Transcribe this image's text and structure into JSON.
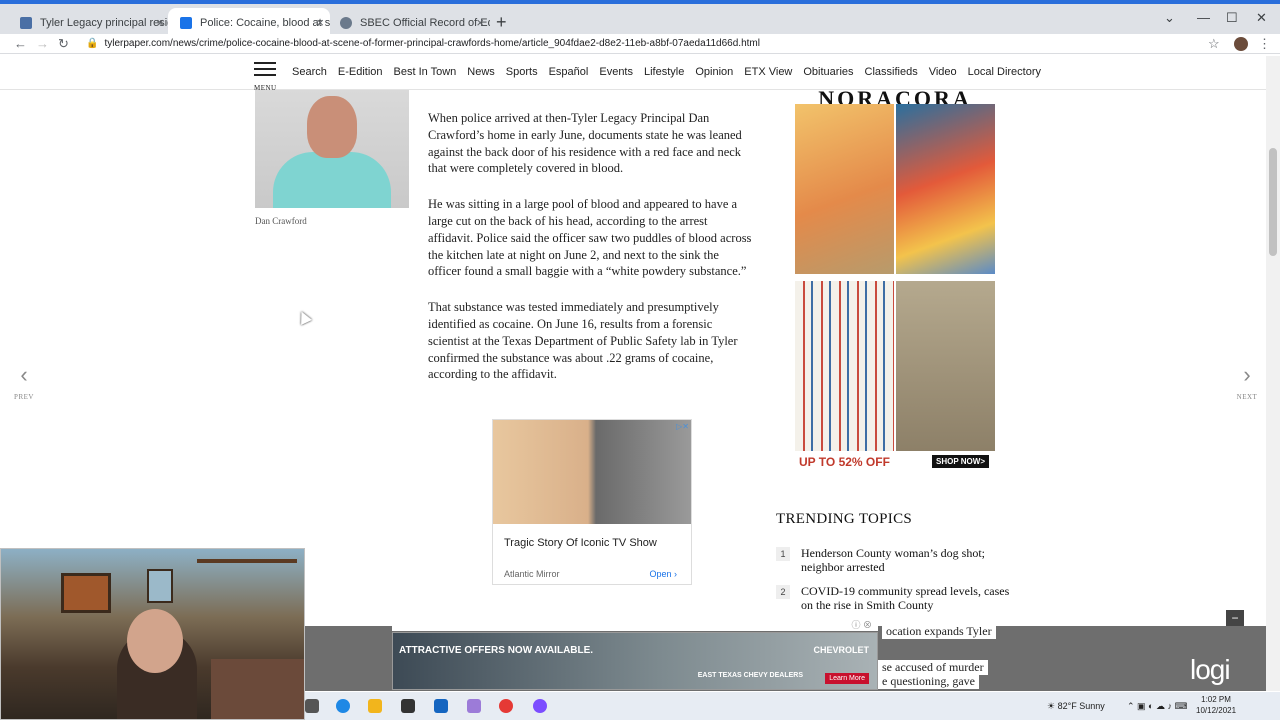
{
  "browser": {
    "tabs": [
      {
        "title": "Tyler Legacy principal resigns in",
        "favicon_color": "#4a6fa5",
        "active": false
      },
      {
        "title": "Police: Cocaine, blood at scene o",
        "favicon_color": "#1a73e8",
        "active": true
      },
      {
        "title": "SBEC Official Record of Educato",
        "favicon_color": "#6b7a8c",
        "active": false
      }
    ],
    "url": "tylerpaper.com/news/crime/police-cocaine-blood-at-scene-of-former-principal-crawfords-home/article_904fdae2-d8e2-11eb-a8bf-07aeda11d66d.html"
  },
  "site_nav": {
    "menu_label": "MENU",
    "links": [
      "Search",
      "E-Edition",
      "Best In Town",
      "News",
      "Sports",
      "Español",
      "Events",
      "Lifestyle",
      "Opinion",
      "ETX View",
      "Obituaries",
      "Classifieds",
      "Video",
      "Local Directory"
    ]
  },
  "article": {
    "photo_caption": "Dan Crawford",
    "paragraphs": [
      "When police arrived at then-Tyler Legacy Principal Dan Crawford’s home in early June, documents state he was leaned against the back door of his residence with a red face and neck that were completely covered in blood.",
      "He was sitting in a large pool of blood and appeared to have a large cut on the back of his head, according to the arrest affidavit. Police said the officer saw two puddles of blood across the kitchen late at night on June 2, and next to the sink the officer found a small baggie with a “white powdery substance.”",
      "That substance was tested immediately and presumptively identified as cocaine. On June 16, results from a forensic scientist at the Texas Department of Public Safety lab in Tyler confirmed the substance was about .22 grams of cocaine, according to the affidavit."
    ]
  },
  "inline_ad": {
    "title": "Tragic Story Of Iconic TV Show",
    "source": "Atlantic Mirror",
    "open_label": "Open"
  },
  "right_ad": {
    "brand": "NORACORA",
    "promo": "UP TO 52% OFF",
    "shop_label": "SHOP NOW>"
  },
  "trending": {
    "title": "TRENDING TOPICS",
    "items": [
      {
        "num": "1",
        "text": "Henderson County woman’s dog shot; neighbor arrested"
      },
      {
        "num": "2",
        "text": "COVID-19 community spread levels, cases on the rise in Smith County"
      },
      {
        "num": "",
        "text": "ocation expands Tyler"
      },
      {
        "num": "",
        "text": "se accused of murder"
      },
      {
        "num": "",
        "text": "e questioning, gave"
      }
    ]
  },
  "pager": {
    "prev": "PREV",
    "next": "NEXT"
  },
  "banner_ad": {
    "headline": "ATTRACTIVE OFFERS NOW AVAILABLE.",
    "brand": "CHEVROLET",
    "dealers": "EAST TEXAS CHEVY DEALERS",
    "learn": "Learn More"
  },
  "overlay": {
    "logo": "logi"
  },
  "taskbar": {
    "weather": "82°F  Sunny",
    "time": "1:02 PM",
    "date": "10/12/2021"
  }
}
